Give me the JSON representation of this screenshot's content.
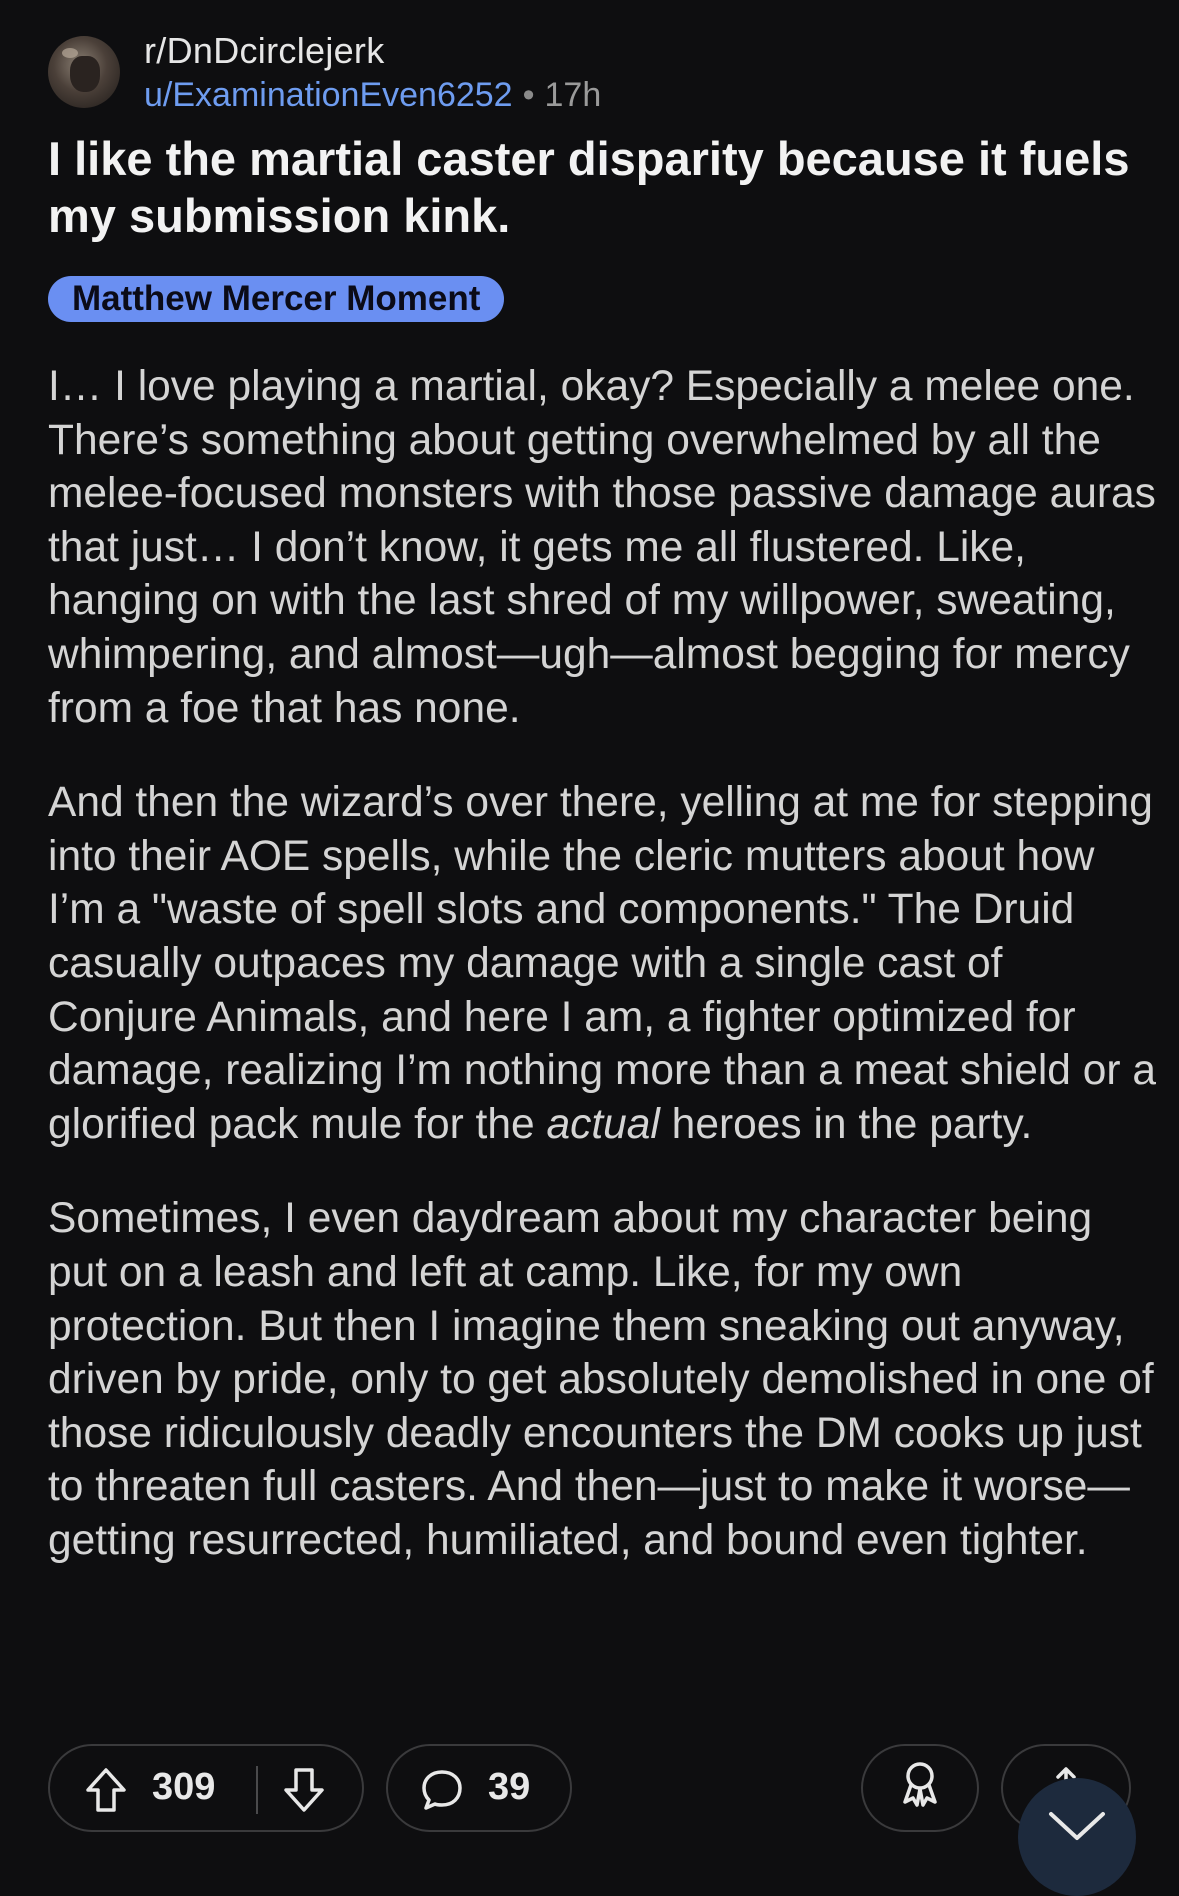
{
  "header": {
    "subreddit": "r/DnDcirclejerk",
    "username": "u/ExaminationEven6252",
    "separator": "•",
    "age": "17h"
  },
  "post": {
    "title": "I like the martial caster disparity because it fuels my submission kink.",
    "flair": "Matthew Mercer Moment",
    "paragraphs": [
      "I… I love playing a martial, okay? Especially a melee one. There’s something about getting overwhelmed by all the melee-focused monsters with those passive damage auras that just… I don’t know, it gets me all flustered. Like, hanging on with the last shred of my willpower, sweating, whimpering, and almost—ugh—almost begging for mercy from a foe that has none.",
      {
        "before": "And then the wizard’s over there, yelling at me for stepping into their AOE spells, while the cleric mutters about how I’m a \"waste of spell slots and components.\" The Druid casually outpaces my damage with a single cast of Conjure Animals, and here I am, a fighter optimized for damage, realizing I’m nothing more than a meat shield or a glorified pack mule for the ",
        "emphasis": "actual",
        "after": " heroes in the party."
      },
      "Sometimes, I even daydream about my character being put on a leash and left at camp. Like, for my own protection. But then I imagine them sneaking out anyway, driven by pride, only to get absolutely demolished in one of those ridiculously deadly encounters the DM cooks up just to threaten full casters. And then—just to make it worse—getting resurrected, humiliated, and bound even tighter."
    ]
  },
  "actions": {
    "upvotes": "309",
    "comments": "39",
    "upvote_icon": "arrow-up-icon",
    "downvote_icon": "arrow-down-icon",
    "comment_icon": "speech-bubble-icon",
    "award_icon": "award-icon",
    "share_icon": "share-icon",
    "scroll_icon": "chevron-down-icon"
  }
}
